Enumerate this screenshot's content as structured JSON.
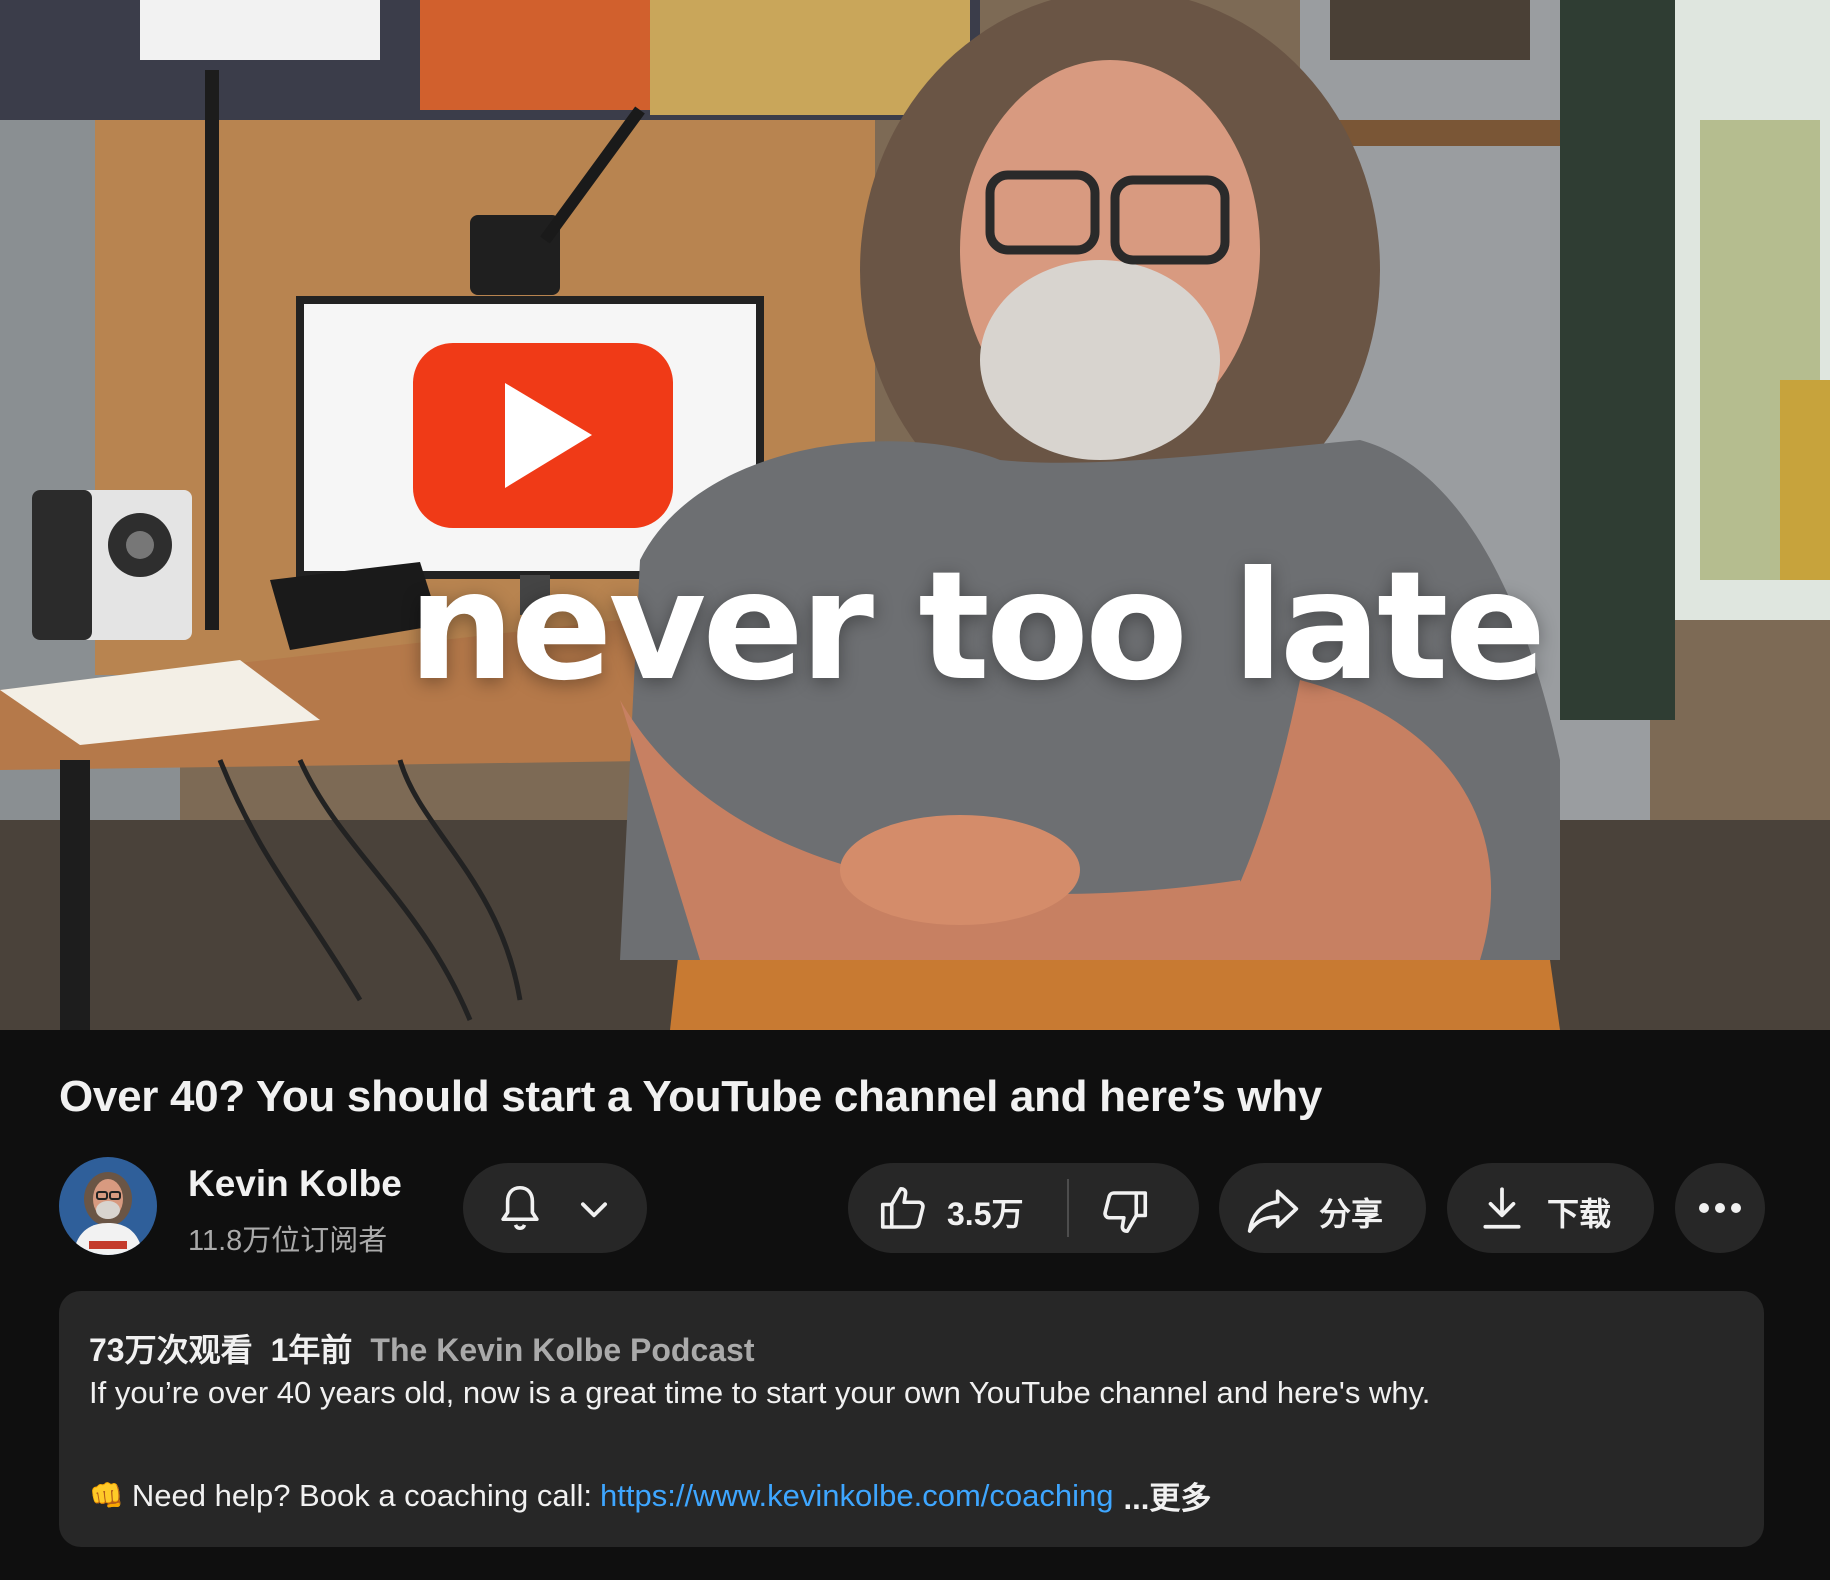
{
  "player": {
    "overlay_text": "never too late"
  },
  "video": {
    "title": "Over 40? You should start a YouTube channel and here’s why"
  },
  "owner": {
    "channel_name": "Kevin Kolbe",
    "subscribers": "11.8万位订阅者"
  },
  "actions": {
    "like_count": "3.5万",
    "share_label": "分享",
    "download_label": "下载"
  },
  "description": {
    "views": "73万次观看",
    "age": "1年前",
    "podcast": "The Kevin Kolbe Podcast",
    "line1": "If you’re over 40 years old, now is a great time to start your own YouTube channel and here's why.",
    "line2_emoji": "👊",
    "line2_text": "Need help? Book a coaching call:",
    "link": "https://www.kevinkolbe.com/coaching",
    "more_label": "...更多"
  },
  "colors": {
    "background": "#0f0f0f",
    "pill": "#272727",
    "link": "#3ea6ff",
    "secondary_text": "#aaaaaa",
    "youtube_red": "#f03a17"
  }
}
